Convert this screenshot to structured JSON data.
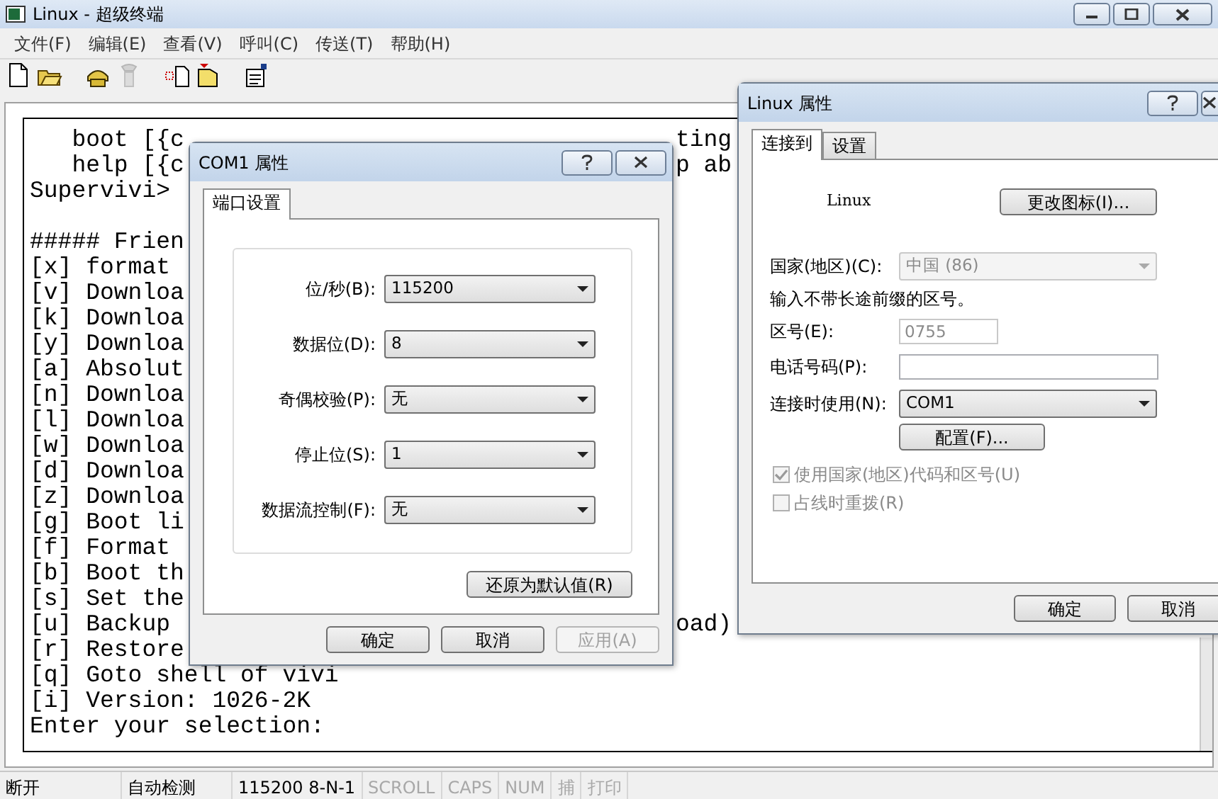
{
  "window": {
    "title": "Linux - 超级终端"
  },
  "menu": [
    "文件(F)",
    "编辑(E)",
    "查看(V)",
    "呼叫(C)",
    "传送(T)",
    "帮助(H)"
  ],
  "toolbar": [
    {
      "kind": "new",
      "enabled": true
    },
    {
      "kind": "open",
      "enabled": true
    },
    {
      "kind": "call",
      "enabled": true
    },
    {
      "kind": "hangup",
      "enabled": false
    },
    {
      "kind": "send",
      "enabled": true
    },
    {
      "kind": "receive",
      "enabled": true
    },
    {
      "kind": "properties",
      "enabled": true
    }
  ],
  "terminal": {
    "blocks": [
      {
        "lines": [
          {
            "text": "   boot [{c",
            "right": "ting"
          },
          {
            "text": "   help [{c",
            "right": "p ab"
          },
          {
            "text": "Supervivi>"
          }
        ]
      },
      {
        "lines": [
          {
            "text": "##### Frien"
          },
          {
            "text": "[x] format"
          },
          {
            "text": "[v] Downloa"
          },
          {
            "text": "[k] Downloa"
          },
          {
            "text": "[y] Downloa"
          },
          {
            "text": "[a] Absolut"
          },
          {
            "text": "[n] Downloa"
          },
          {
            "text": "[l] Downloa"
          },
          {
            "text": "[w] Downloa"
          },
          {
            "text": "[d] Downloa"
          },
          {
            "text": "[z] Downloa"
          },
          {
            "text": "[g] Boot li"
          },
          {
            "text": "[f] Format"
          },
          {
            "text": "[b] Boot th"
          },
          {
            "text": "[s] Set the"
          },
          {
            "text": "[u] Backup",
            "right": "oad)"
          },
          {
            "text": "[r] Restore"
          },
          {
            "text": "[q] Goto shell of vivi"
          },
          {
            "text": "[i] Version: 1026-2K"
          },
          {
            "text": "Enter your selection:"
          }
        ]
      }
    ]
  },
  "status_bar": [
    {
      "text": "断开",
      "enabled": true
    },
    {
      "text": "自动检测",
      "enabled": true
    },
    {
      "text": "115200 8-N-1",
      "enabled": true
    },
    {
      "text": "SCROLL",
      "enabled": false
    },
    {
      "text": "CAPS",
      "enabled": false
    },
    {
      "text": "NUM",
      "enabled": false
    },
    {
      "text": "捕",
      "enabled": false
    },
    {
      "text": "打印",
      "enabled": false
    }
  ],
  "com_dialog": {
    "title": "COM1 属性",
    "tabs": [
      {
        "label": "端口设置",
        "selected": true
      }
    ],
    "fields": [
      {
        "label": "位/秒(B):",
        "value": "115200"
      },
      {
        "label": "数据位(D):",
        "value": "8"
      },
      {
        "label": "奇偶校验(P):",
        "value": "无"
      },
      {
        "label": "停止位(S):",
        "value": "1"
      },
      {
        "label": "数据流控制(F):",
        "value": "无"
      }
    ],
    "restore_button": "还原为默认值(R)",
    "buttons": [
      {
        "label": "确定",
        "disabled": false
      },
      {
        "label": "取消",
        "disabled": false
      },
      {
        "label": "应用(A)",
        "disabled": true
      }
    ]
  },
  "linux_dialog": {
    "title": "Linux 属性",
    "tabs": [
      {
        "label": "连接到",
        "selected": true
      },
      {
        "label": "设置",
        "selected": false
      }
    ],
    "connection_name": "Linux",
    "change_icon_button": "更改图标(I)...",
    "country": {
      "label": "国家(地区)(C):",
      "value": "中国 (86)",
      "disabled": true
    },
    "hint": "输入不带长途前缀的区号。",
    "area_code": {
      "label": "区号(E):",
      "value": "0755",
      "disabled": true
    },
    "phone": {
      "label": "电话号码(P):",
      "disabled": false
    },
    "connect_using": {
      "label": "连接时使用(N):",
      "value": "COM1",
      "disabled": false
    },
    "configure_button": "配置(F)...",
    "checkboxes": [
      {
        "label": "使用国家(地区)代码和区号(U)",
        "checked": true,
        "disabled": true
      },
      {
        "label": "占线时重拨(R)",
        "checked": false,
        "disabled": true
      }
    ],
    "buttons": [
      {
        "label": "确定",
        "disabled": false
      },
      {
        "label": "取消",
        "disabled": false
      }
    ]
  }
}
